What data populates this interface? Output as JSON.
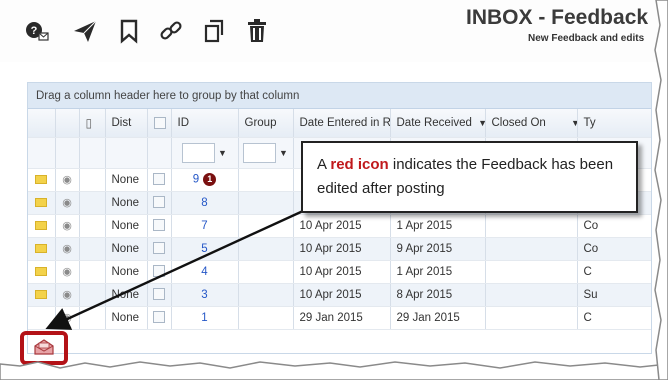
{
  "toolbar": {
    "icons": [
      "question-mail-icon",
      "send-icon",
      "bookmark-icon",
      "link-icon",
      "copy-icon",
      "trash-icon"
    ]
  },
  "header": {
    "title": "INBOX - Feedback",
    "subtitle": "New Feedback and edits"
  },
  "grid": {
    "group_hint": "Drag a column header here to group by that column",
    "columns": [
      "Dist",
      "ID",
      "Group",
      "Date Entered in Risk",
      "Date Received",
      "Closed On",
      "Ty"
    ],
    "rows": [
      {
        "dist": "None",
        "id": "9",
        "date_entered": "",
        "date_received": "",
        "type": "C"
      },
      {
        "dist": "None",
        "id": "8",
        "date_entered": "",
        "date_received": "",
        "type": "S"
      },
      {
        "dist": "None",
        "id": "7",
        "date_entered": "10 Apr 2015",
        "date_received": "1 Apr 2015",
        "type": "Co"
      },
      {
        "dist": "None",
        "id": "5",
        "date_entered": "10 Apr 2015",
        "date_received": "9 Apr 2015",
        "type": "Co"
      },
      {
        "dist": "None",
        "id": "4",
        "date_entered": "10 Apr 2015",
        "date_received": "1 Apr 2015",
        "type": "C"
      },
      {
        "dist": "None",
        "id": "3",
        "date_entered": "10 Apr 2015",
        "date_received": "8 Apr 2015",
        "type": "Su"
      },
      {
        "dist": "None",
        "id": "1",
        "date_entered": "29 Jan 2015",
        "date_received": "29 Jan 2015",
        "type": "C"
      }
    ],
    "badge": "1"
  },
  "callout": {
    "prefix": "A ",
    "highlight": "red icon",
    "suffix": " indicates the Feedback has been edited after posting"
  },
  "colors": {
    "accent_red": "#b31217",
    "header_blue": "#dde8f4",
    "id_link": "#2557c7"
  }
}
